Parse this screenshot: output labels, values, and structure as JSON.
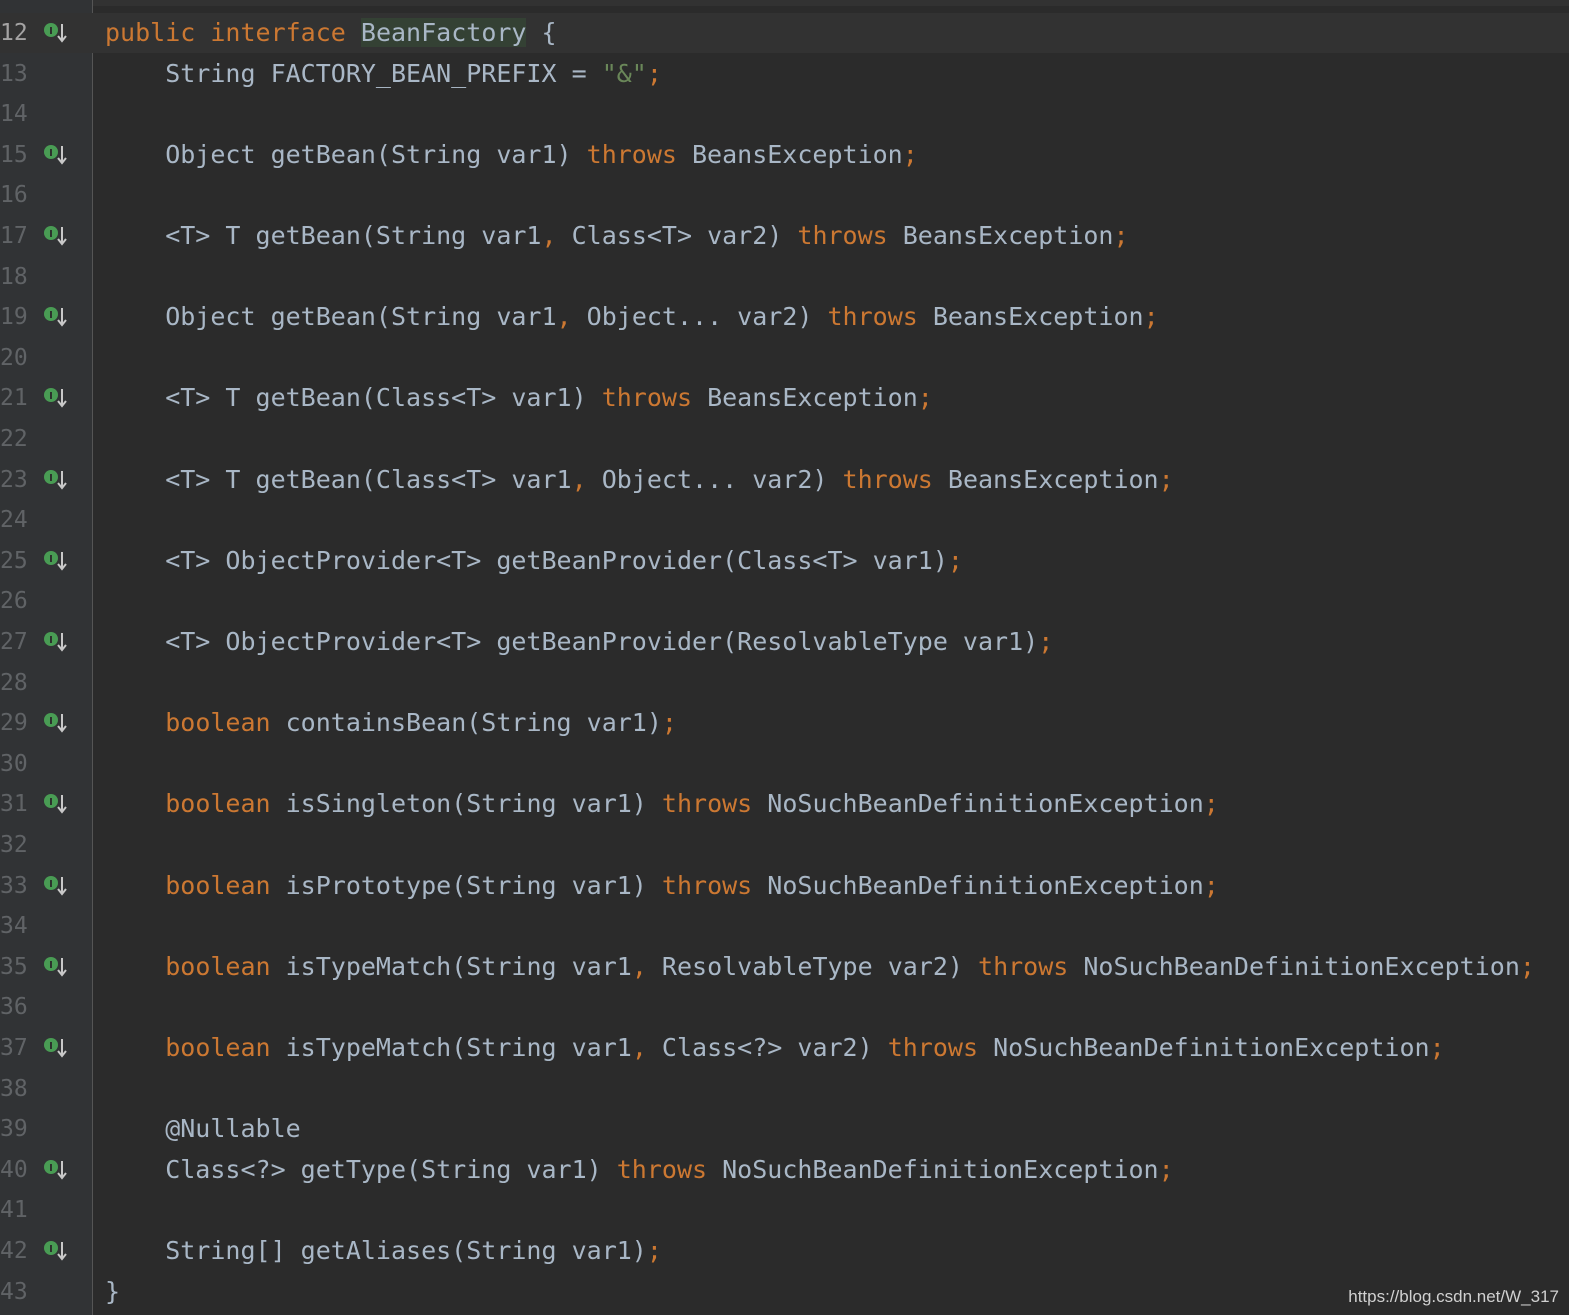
{
  "editor": {
    "lines": [
      {
        "num": "12",
        "marker": true,
        "current": true
      },
      {
        "num": "13",
        "marker": false
      },
      {
        "num": "14",
        "marker": false
      },
      {
        "num": "15",
        "marker": true
      },
      {
        "num": "16",
        "marker": false
      },
      {
        "num": "17",
        "marker": true
      },
      {
        "num": "18",
        "marker": false
      },
      {
        "num": "19",
        "marker": true
      },
      {
        "num": "20",
        "marker": false
      },
      {
        "num": "21",
        "marker": true
      },
      {
        "num": "22",
        "marker": false
      },
      {
        "num": "23",
        "marker": true
      },
      {
        "num": "24",
        "marker": false
      },
      {
        "num": "25",
        "marker": true
      },
      {
        "num": "26",
        "marker": false
      },
      {
        "num": "27",
        "marker": true
      },
      {
        "num": "28",
        "marker": false
      },
      {
        "num": "29",
        "marker": true
      },
      {
        "num": "30",
        "marker": false
      },
      {
        "num": "31",
        "marker": true
      },
      {
        "num": "32",
        "marker": false
      },
      {
        "num": "33",
        "marker": true
      },
      {
        "num": "34",
        "marker": false
      },
      {
        "num": "35",
        "marker": true
      },
      {
        "num": "36",
        "marker": false
      },
      {
        "num": "37",
        "marker": true
      },
      {
        "num": "38",
        "marker": false
      },
      {
        "num": "39",
        "marker": false
      },
      {
        "num": "40",
        "marker": true
      },
      {
        "num": "41",
        "marker": false
      },
      {
        "num": "42",
        "marker": true
      },
      {
        "num": "43",
        "marker": false
      }
    ],
    "code": {
      "l12_kw1": "public",
      "l12_kw2": "interface",
      "l12_name": "BeanFactory",
      "l12_rest": " {",
      "l13_a": "    String FACTORY_BEAN_PREFIX = ",
      "l13_str": "\"&\"",
      "l13_semi": ";",
      "l15_a": "    Object getBean(String var1) ",
      "l15_throws": "throws",
      "l15_b": " BeansException",
      "l15_semi": ";",
      "l17_a": "    <T> T getBean(String var1",
      "l17_comma": ",",
      "l17_b": " Class<T> var2) ",
      "l17_throws": "throws",
      "l17_c": " BeansException",
      "l17_semi": ";",
      "l19_a": "    Object getBean(String var1",
      "l19_comma": ",",
      "l19_b": " Object... var2) ",
      "l19_throws": "throws",
      "l19_c": " BeansException",
      "l19_semi": ";",
      "l21_a": "    <T> T getBean(Class<T> var1) ",
      "l21_throws": "throws",
      "l21_b": " BeansException",
      "l21_semi": ";",
      "l23_a": "    <T> T getBean(Class<T> var1",
      "l23_comma": ",",
      "l23_b": " Object... var2) ",
      "l23_throws": "throws",
      "l23_c": " BeansException",
      "l23_semi": ";",
      "l25_a": "    <T> ObjectProvider<T> getBeanProvider(Class<T> var1)",
      "l25_semi": ";",
      "l27_a": "    <T> ObjectProvider<T> getBeanProvider(ResolvableType var1)",
      "l27_semi": ";",
      "l29_kw": "boolean",
      "l29_a": " containsBean(String var1)",
      "l29_semi": ";",
      "l31_kw": "boolean",
      "l31_a": " isSingleton(String var1) ",
      "l31_throws": "throws",
      "l31_b": " NoSuchBeanDefinitionException",
      "l31_semi": ";",
      "l33_kw": "boolean",
      "l33_a": " isPrototype(String var1) ",
      "l33_throws": "throws",
      "l33_b": " NoSuchBeanDefinitionException",
      "l33_semi": ";",
      "l35_kw": "boolean",
      "l35_a": " isTypeMatch(String var1",
      "l35_comma": ",",
      "l35_b": " ResolvableType var2) ",
      "l35_throws": "throws",
      "l35_c": " NoSuchBeanDefinitionException",
      "l35_semi": ";",
      "l37_kw": "boolean",
      "l37_a": " isTypeMatch(String var1",
      "l37_comma": ",",
      "l37_b": " Class<?> var2) ",
      "l37_throws": "throws",
      "l37_c": " NoSuchBeanDefinitionException",
      "l37_semi": ";",
      "l39_ann": "    @Nullable",
      "l40_a": "    Class<?> getType(String var1) ",
      "l40_throws": "throws",
      "l40_b": " NoSuchBeanDefinitionException",
      "l40_semi": ";",
      "l42_a": "    String[] getAliases(String var1)",
      "l42_semi": ";",
      "l43_a": "}"
    }
  },
  "watermark": "https://blog.csdn.net/W_317",
  "colors": {
    "background": "#2b2b2b",
    "gutter": "#313335",
    "text": "#a9b7c6",
    "keyword": "#cc7832",
    "string": "#6a8759",
    "marker": "#499c54"
  },
  "icons": {
    "gutter_marker": "implemented-method-down-arrow-icon"
  }
}
